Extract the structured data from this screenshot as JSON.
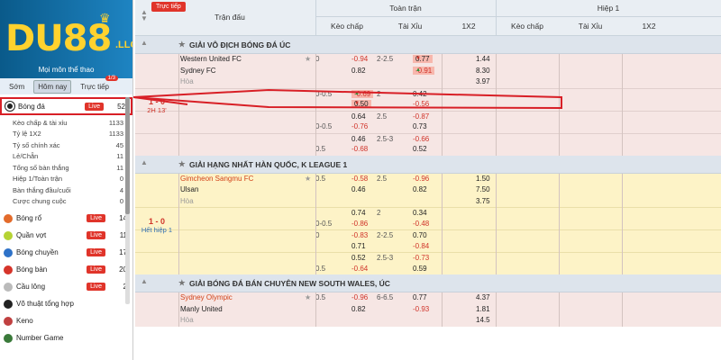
{
  "sidebar": {
    "logo_text": "DU88",
    "logo_suffix": ".LLC",
    "sports_heading": "Mọi môn thể thao",
    "period_tabs": [
      {
        "label": "Sớm",
        "active": false
      },
      {
        "label": "Hôm nay",
        "active": true
      },
      {
        "label": "Trực tiếp",
        "active": false,
        "badge": "1/3"
      }
    ],
    "football": {
      "label": "Bóng đá",
      "live": "Live",
      "count": "52"
    },
    "football_subs": [
      {
        "label": "Kèo chấp & tài xỉu",
        "count": "1133"
      },
      {
        "label": "Tỷ lệ 1X2",
        "count": "1133"
      },
      {
        "label": "Tỷ số chính xác",
        "count": "45"
      },
      {
        "label": "Lẻ/Chẵn",
        "count": "11"
      },
      {
        "label": "Tổng số bàn thắng",
        "count": "11"
      },
      {
        "label": "Hiệp 1/Toàn trận",
        "count": "0"
      },
      {
        "label": "Bàn thắng đầu/cuối",
        "count": "4"
      },
      {
        "label": "Cược chung cuộc",
        "count": "0"
      }
    ],
    "sports": [
      {
        "label": "Bóng rổ",
        "live": "Live",
        "count": "14",
        "color": "#e36b2b"
      },
      {
        "label": "Quần vợt",
        "live": "Live",
        "count": "11",
        "color": "#b5d334"
      },
      {
        "label": "Bóng chuyền",
        "live": "Live",
        "count": "17",
        "color": "#2e72c8"
      },
      {
        "label": "Bóng bàn",
        "live": "Live",
        "count": "20",
        "color": "#d6342a"
      },
      {
        "label": "Cầu lông",
        "live": "Live",
        "count": "2",
        "color": "#bbbbbb"
      },
      {
        "label": "Võ thuật tổng hợp",
        "live": "",
        "count": "",
        "color": "#222222"
      },
      {
        "label": "Keno",
        "live": "",
        "count": "",
        "color": "#c04040"
      },
      {
        "label": "Number Game",
        "live": "",
        "count": "",
        "color": "#3a7a3a"
      }
    ]
  },
  "header": {
    "live_pill": "Trực tiếp",
    "match_col": "Trận đấu",
    "full_match": "Toàn trận",
    "first_half": "Hiệp 1",
    "handicap": "Kèo chấp",
    "over_under": "Tài Xỉu",
    "one_x_two": "1X2",
    "handicap_h1": "Kèo chấp",
    "over_under_h1": "Tài Xỉu",
    "one_x_two_h1": "1X2"
  },
  "leagues": [
    {
      "name": "GIẢI VÔ ĐỊCH BÓNG ĐÁ ÚC",
      "bg": "pink",
      "score": "1 - 0",
      "time": "2H 13'",
      "home": "Western United FC",
      "away": "Sydney FC",
      "draw": "Hòa",
      "home_hot": false,
      "rows": [
        {
          "hcap": "0",
          "kc": "-0.94",
          "line": "2-2.5",
          "tx": "0.77",
          "tx_arrow": "down",
          "x12": "1.44",
          "star": true,
          "team": "home"
        },
        {
          "hcap": "",
          "kc": "0.82",
          "line": "",
          "tx": "-0.91",
          "tx_arrow": "up",
          "x12": "8.30",
          "team": "away"
        },
        {
          "hcap": "",
          "kc": "",
          "line": "",
          "tx": "",
          "x12": "3.97",
          "team": "draw"
        },
        {
          "hcap": "0-0.5",
          "kc": "-0.69",
          "line": "2",
          "tx": "0.42",
          "x12": "",
          "sep": true,
          "kc_arrow": "up"
        },
        {
          "hcap": "",
          "kc": "0.50",
          "line": "",
          "tx": "-0.56",
          "x12": "",
          "kc_arrow": "down"
        },
        {
          "hcap": "",
          "kc": "0.64",
          "line": "2.5",
          "tx": "-0.87",
          "x12": "",
          "sep": true
        },
        {
          "hcap": "0-0.5",
          "kc": "-0.76",
          "line": "",
          "tx": "0.73",
          "x12": ""
        },
        {
          "hcap": "",
          "kc": "0.46",
          "line": "2.5-3",
          "tx": "-0.66",
          "x12": "",
          "sep": true
        },
        {
          "hcap": "0.5",
          "kc": "-0.68",
          "line": "",
          "tx": "0.52",
          "x12": ""
        }
      ]
    },
    {
      "name": "GIẢI HẠNG NHẤT HÀN QUỐC, K LEAGUE 1",
      "bg": "yellow",
      "score": "1 - 0",
      "time": "Hết hiệp 1",
      "home": "Gimcheon Sangmu FC",
      "away": "Ulsan",
      "draw": "Hòa",
      "home_hot": true,
      "rows": [
        {
          "hcap": "0.5",
          "kc": "-0.58",
          "line": "2.5",
          "tx": "-0.96",
          "x12": "1.50",
          "star": true,
          "team": "home"
        },
        {
          "hcap": "",
          "kc": "0.46",
          "line": "",
          "tx": "0.82",
          "x12": "7.50",
          "team": "away"
        },
        {
          "hcap": "",
          "kc": "",
          "line": "",
          "tx": "",
          "x12": "3.75",
          "team": "draw"
        },
        {
          "hcap": "",
          "kc": "0.74",
          "line": "2",
          "tx": "0.34",
          "x12": "",
          "sep": true
        },
        {
          "hcap": "0-0.5",
          "kc": "-0.86",
          "line": "",
          "tx": "-0.48",
          "x12": ""
        },
        {
          "hcap": "0",
          "kc": "-0.83",
          "line": "2-2.5",
          "tx": "0.70",
          "x12": "",
          "sep": true
        },
        {
          "hcap": "",
          "kc": "0.71",
          "line": "",
          "tx": "-0.84",
          "x12": ""
        },
        {
          "hcap": "",
          "kc": "0.52",
          "line": "2.5-3",
          "tx": "-0.73",
          "x12": "",
          "sep": true
        },
        {
          "hcap": "0.5",
          "kc": "-0.64",
          "line": "",
          "tx": "0.59",
          "x12": ""
        }
      ]
    },
    {
      "name": "GIẢI BÓNG ĐÁ BÁN CHUYÊN NEW SOUTH WALES, ÚC",
      "bg": "pink",
      "score": "",
      "time": "",
      "home": "Sydney Olympic",
      "away": "Manly United",
      "draw": "Hòa",
      "home_hot": true,
      "rows": [
        {
          "hcap": "0.5",
          "kc": "-0.96",
          "line": "6-6.5",
          "tx": "0.77",
          "x12": "4.37",
          "star": true,
          "team": "home"
        },
        {
          "hcap": "",
          "kc": "0.82",
          "line": "",
          "tx": "-0.93",
          "x12": "1.81",
          "team": "away"
        },
        {
          "hcap": "",
          "kc": "",
          "line": "",
          "tx": "",
          "x12": "14.5",
          "team": "draw"
        }
      ]
    }
  ],
  "colors": {
    "accent": "#d0342a",
    "header_bg": "#e9eef3",
    "pink_bg": "#f6e6e4",
    "yellow_bg": "#fdf3c7",
    "sidebar_blue": "#1e84c2",
    "highlight": "#d81f26"
  },
  "icons": {
    "football": "soccer-ball-icon",
    "star": "star-icon",
    "collapse": "chevron-up-icon"
  }
}
